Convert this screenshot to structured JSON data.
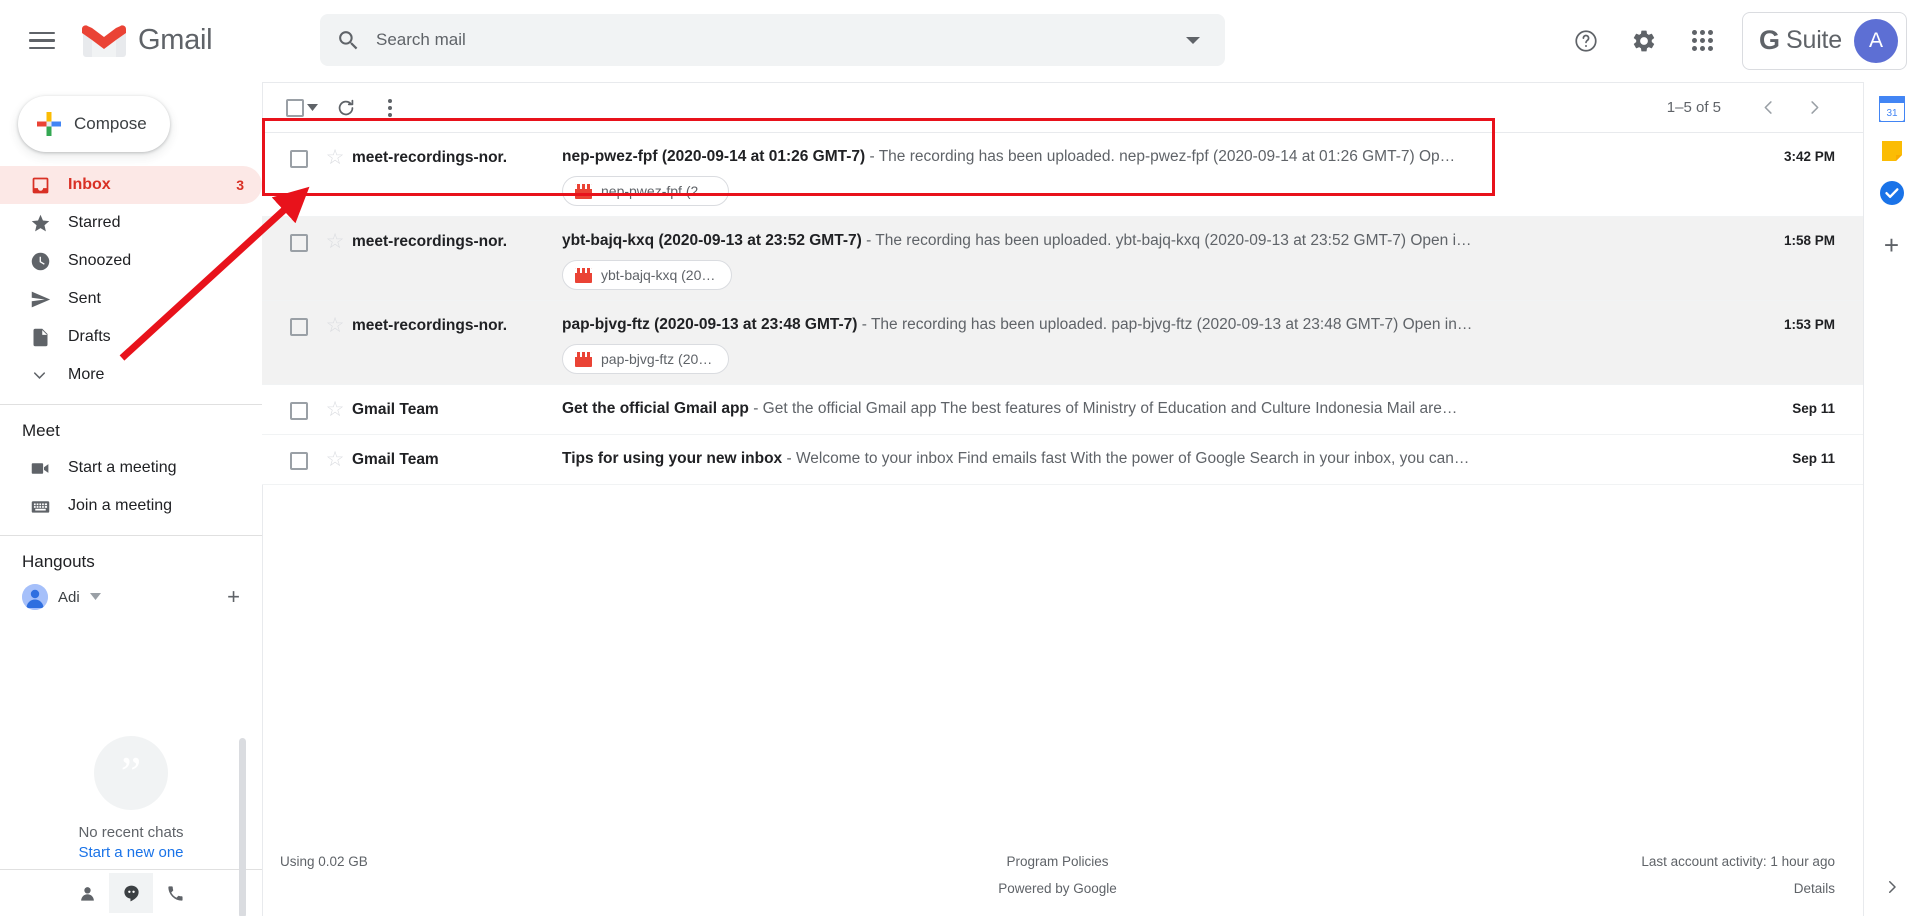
{
  "header": {
    "menu_icon": "hamburger-icon",
    "logo_text": "Gmail",
    "search": {
      "placeholder": "Search mail",
      "value": "",
      "search_icon": "search-icon",
      "options_icon": "chevron-down-icon"
    },
    "help_icon": "help-icon",
    "settings_icon": "gear-icon",
    "apps_icon": "apps-grid-icon",
    "gsuite_g": "G",
    "gsuite_label": "Suite",
    "avatar_initial": "A",
    "accent_color": "#d93025",
    "avatar_color": "#5d6fd4"
  },
  "sidebar": {
    "compose_label": "Compose",
    "items": [
      {
        "label": "Inbox",
        "icon": "inbox-icon",
        "count": "3",
        "active": true
      },
      {
        "label": "Starred",
        "icon": "star-icon",
        "count": "",
        "active": false
      },
      {
        "label": "Snoozed",
        "icon": "clock-icon",
        "count": "",
        "active": false
      },
      {
        "label": "Sent",
        "icon": "send-icon",
        "count": "",
        "active": false
      },
      {
        "label": "Drafts",
        "icon": "draft-icon",
        "count": "",
        "active": false
      },
      {
        "label": "More",
        "icon": "chevron-down-icon",
        "count": "",
        "active": false
      }
    ],
    "meet": {
      "title": "Meet",
      "items": [
        {
          "label": "Start a meeting",
          "icon": "video-camera-icon"
        },
        {
          "label": "Join a meeting",
          "icon": "keyboard-icon"
        }
      ]
    },
    "hangouts": {
      "title": "Hangouts",
      "user_name": "Adi",
      "user_caret": "caret-down-icon",
      "add_icon": "plus-icon",
      "empty_title": "No recent chats",
      "empty_link": "Start a new one",
      "tabs": [
        {
          "icon": "contacts-icon",
          "selected": false
        },
        {
          "icon": "hangouts-icon",
          "selected": true
        },
        {
          "icon": "phone-icon",
          "selected": false
        }
      ]
    }
  },
  "toolbar": {
    "select_all_icon": "checkbox-icon",
    "select_all_caret": "caret-down-icon",
    "refresh_icon": "refresh-icon",
    "more_icon": "kebab-menu-icon",
    "page_range": "1–5 of 5",
    "prev_icon": "chevron-left-icon",
    "next_icon": "chevron-right-icon"
  },
  "mail_list": {
    "rows": [
      {
        "sender": "meet-recordings-nor.",
        "subject": "nep-pwez-fpf (2020-09-14 at 01:26 GMT-7)",
        "snippet": "- The recording has been uploaded. nep-pwez-fpf (2020-09-14 at 01:26 GMT-7) Op…",
        "date": "3:42 PM",
        "unread": false,
        "highlighted": true,
        "attachment": "nep-pwez-fpf (2…"
      },
      {
        "sender": "meet-recordings-nor.",
        "subject": "ybt-bajq-kxq (2020-09-13 at 23:52 GMT-7)",
        "snippet": "- The recording has been uploaded. ybt-bajq-kxq (2020-09-13 at 23:52 GMT-7) Open i…",
        "date": "1:58 PM",
        "unread": true,
        "highlighted": false,
        "attachment": "ybt-bajq-kxq (20…"
      },
      {
        "sender": "meet-recordings-nor.",
        "subject": "pap-bjvg-ftz (2020-09-13 at 23:48 GMT-7)",
        "snippet": "- The recording has been uploaded. pap-bjvg-ftz (2020-09-13 at 23:48 GMT-7) Open in…",
        "date": "1:53 PM",
        "unread": true,
        "highlighted": false,
        "attachment": "pap-bjvg-ftz (20…"
      },
      {
        "sender": "Gmail Team",
        "subject": "Get the official Gmail app",
        "snippet": "- Get the official Gmail app The best features of Ministry of Education and Culture Indonesia Mail are…",
        "date": "Sep 11",
        "unread": false,
        "highlighted": false,
        "attachment": ""
      },
      {
        "sender": "Gmail Team",
        "subject": "Tips for using your new inbox",
        "snippet": "- Welcome to your inbox Find emails fast With the power of Google Search in your inbox, you can…",
        "date": "Sep 11",
        "unread": false,
        "highlighted": false,
        "attachment": ""
      }
    ]
  },
  "footer": {
    "storage": "Using 0.02 GB",
    "program_policies": "Program Policies",
    "powered_by": "Powered by Google",
    "last_activity": "Last account activity: 1 hour ago",
    "details": "Details"
  },
  "right_rail": {
    "calendar_label": "31",
    "items": [
      {
        "icon": "calendar-icon"
      },
      {
        "icon": "keep-icon"
      },
      {
        "icon": "tasks-icon"
      },
      {
        "icon": "add-app-icon"
      }
    ],
    "expand_icon": "chevron-right-icon"
  },
  "annotation": {
    "highlight_color": "#e8121b",
    "arrow_color": "#e8121b"
  }
}
